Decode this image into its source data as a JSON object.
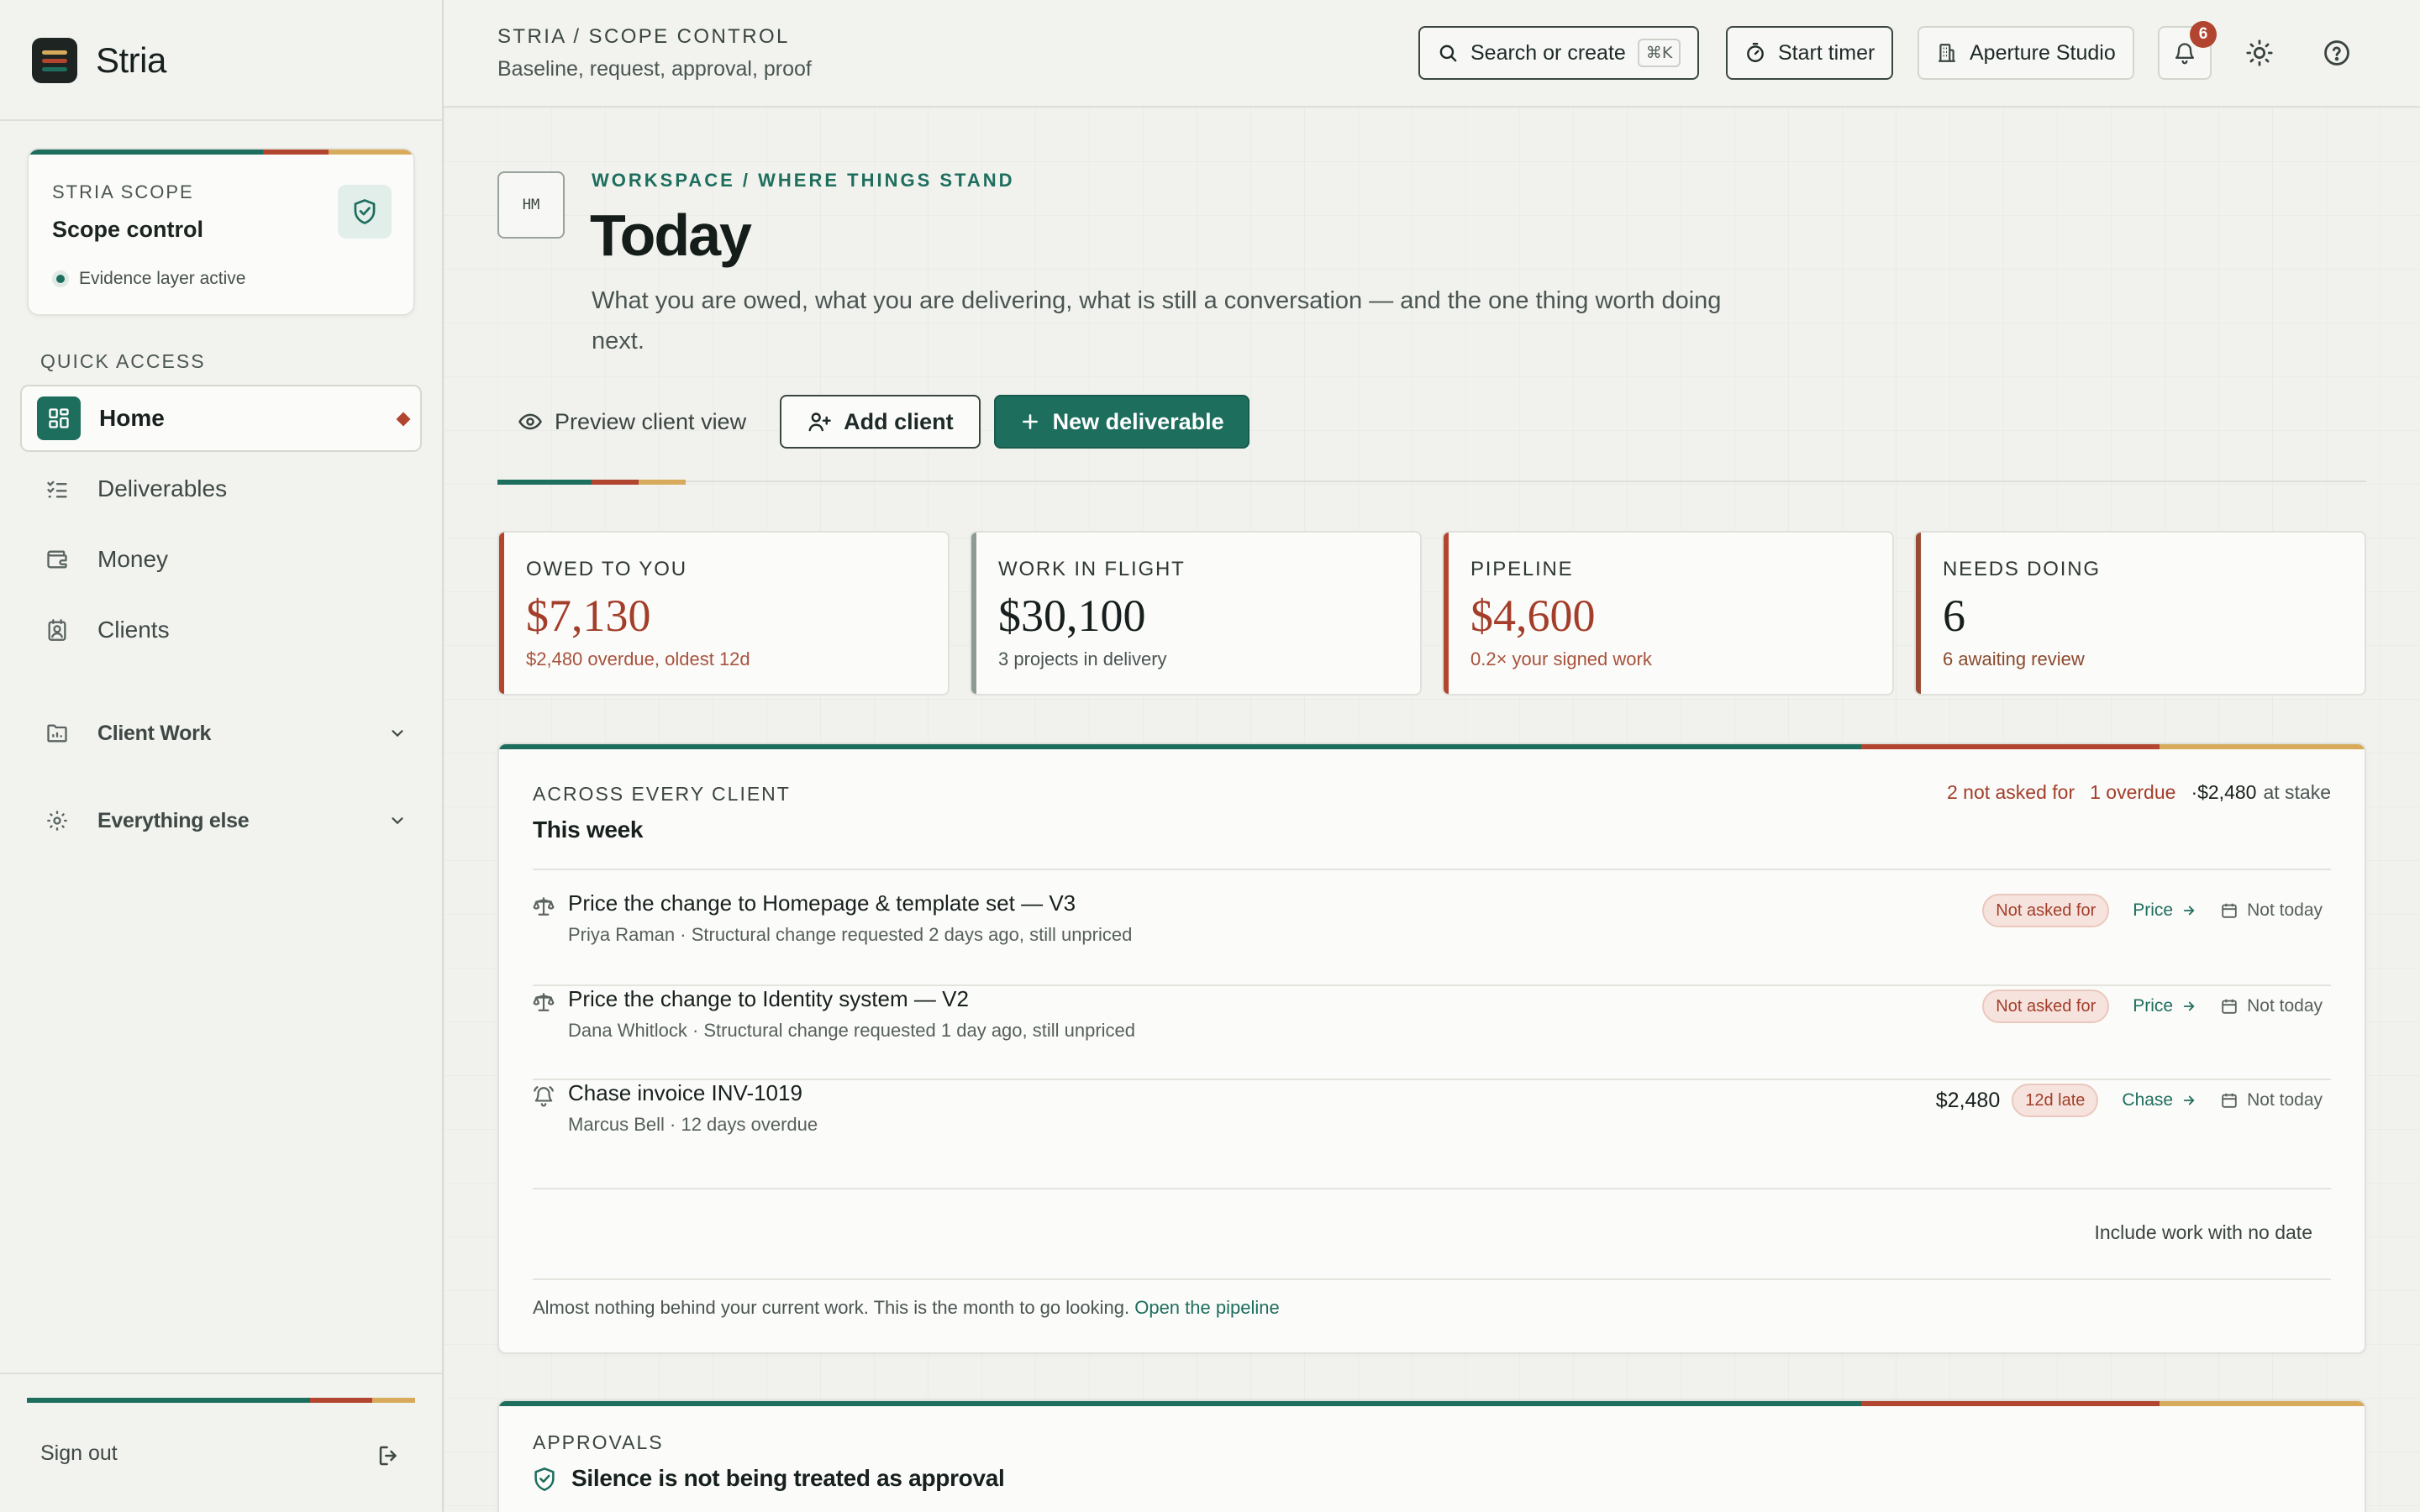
{
  "app": {
    "name": "Stria",
    "brand_stripes": [
      "#d8ab5c",
      "#b2452f",
      "#1e6e5e"
    ]
  },
  "colors": {
    "accent": "#1e6e5e",
    "alert": "#b2452f",
    "warm": "#d8ab5c"
  },
  "sidebar": {
    "scope_card": {
      "eyebrow": "STRIA SCOPE",
      "title": "Scope control",
      "status": "Evidence layer active",
      "icon": "shield-check-icon"
    },
    "quick_access_label": "QUICK ACCESS",
    "nav": [
      {
        "label": "Home",
        "icon": "grid-icon",
        "active": true
      },
      {
        "label": "Deliverables",
        "icon": "checklist-icon",
        "active": false
      },
      {
        "label": "Money",
        "icon": "wallet-icon",
        "active": false
      },
      {
        "label": "Clients",
        "icon": "contact-card-icon",
        "active": false
      }
    ],
    "groups": [
      {
        "label": "Client Work",
        "icon": "folder-chart-icon"
      },
      {
        "label": "Everything else",
        "icon": "gear-icon"
      }
    ],
    "sign_out": "Sign out"
  },
  "topbar": {
    "breadcrumb": "STRIA / SCOPE CONTROL",
    "subtitle": "Baseline, request, approval, proof",
    "search_label": "Search or create",
    "search_shortcut": "⌘K",
    "timer_label": "Start timer",
    "workspace_label": "Aperture Studio",
    "notifications_count": "6"
  },
  "hero": {
    "avatar_initials": "HM",
    "eyebrow": "WORKSPACE / WHERE THINGS STAND",
    "title": "Today",
    "lede": "What you are owed, what you are delivering, what is still a conversation — and the one thing worth doing next.",
    "actions": {
      "preview": "Preview client view",
      "add_client": "Add client",
      "new_deliverable": "New deliverable"
    }
  },
  "stats": [
    {
      "label": "OWED TO YOU",
      "value": "$7,130",
      "sub": "$2,480 overdue, oldest 12d",
      "edge": "#b2452f",
      "value_color": "#a33e2a",
      "sub_color": "#a8533e"
    },
    {
      "label": "WORK IN FLIGHT",
      "value": "$30,100",
      "sub": "3 projects in delivery",
      "edge": "#8e9a96",
      "value_color": "#17201e",
      "sub_color": "#4a5552"
    },
    {
      "label": "PIPELINE",
      "value": "$4,600",
      "sub": "0.2× your signed work",
      "edge": "#b2452f",
      "value_color": "#a33e2a",
      "sub_color": "#a8533e"
    },
    {
      "label": "NEEDS DOING",
      "value": "6",
      "sub": "6 awaiting review",
      "edge": "#9a4a33",
      "value_color": "#17201e",
      "sub_color": "#8a4a2e"
    }
  ],
  "week_panel": {
    "eyebrow": "ACROSS EVERY CLIENT",
    "title": "This week",
    "summary": {
      "not_asked": "2 not asked for",
      "overdue": "1 overdue",
      "stake_amount": "·$2,480",
      "stake_suffix": "at stake"
    },
    "tasks": [
      {
        "icon": "scale-icon",
        "title": "Price the change to Homepage & template set — V3",
        "sub": "Priya Raman · Structural change requested 2 days ago, still unpriced",
        "amount": "",
        "pill": "Not asked for",
        "action": "Price",
        "defer": "Not today"
      },
      {
        "icon": "scale-icon",
        "title": "Price the change to Identity system — V2",
        "sub": "Dana Whitlock · Structural change requested 1 day ago, still unpriced",
        "amount": "",
        "pill": "Not asked for",
        "action": "Price",
        "defer": "Not today"
      },
      {
        "icon": "bell-ringing-icon",
        "title": "Chase invoice INV-1019",
        "sub": "Marcus Bell · 12 days overdue",
        "amount": "$2,480",
        "pill": "12d late",
        "action": "Chase",
        "defer": "Not today"
      }
    ],
    "include_no_date": "Include work with no date",
    "note": "Almost nothing behind your current work. This is the month to go looking.",
    "note_link": "Open the pipeline"
  },
  "approvals_panel": {
    "eyebrow": "APPROVALS",
    "title": "Silence is not being treated as approval"
  }
}
